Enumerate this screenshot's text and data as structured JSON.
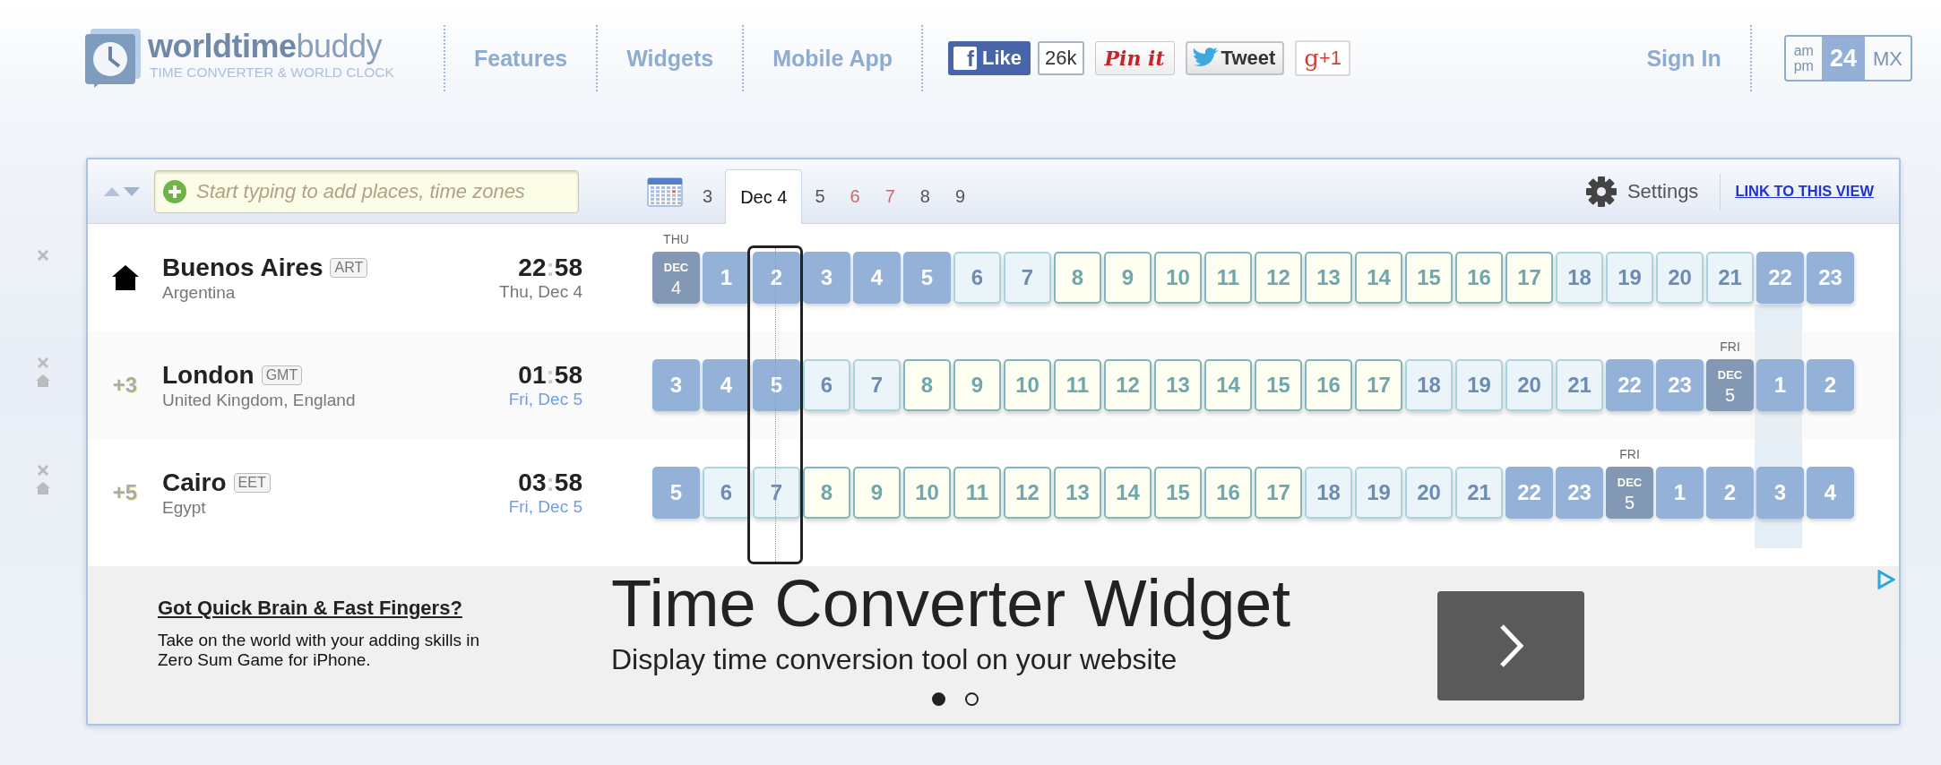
{
  "header": {
    "logo": {
      "text": "**worldtime**buddy",
      "tagline": "TIME CONVERTER & WORLD CLOCK"
    },
    "nav": [
      {
        "label": "Features"
      },
      {
        "label": "Widgets"
      },
      {
        "label": "Mobile App"
      }
    ],
    "social": [
      {
        "kind": "facebook",
        "icon_text": "f",
        "label": "Like",
        "count": "26k"
      },
      {
        "kind": "pinterest",
        "label": "Pin it"
      },
      {
        "kind": "twitter",
        "label": "Tweet"
      },
      {
        "kind": "google",
        "icon_text": "g",
        "label": "+1"
      }
    ],
    "sign_in": "Sign In",
    "time_format": [
      {
        "lines": [
          "am",
          "pm"
        ],
        "selected": false
      },
      {
        "lines": [
          "24"
        ],
        "selected": true
      },
      {
        "lines": [
          "MX"
        ],
        "selected": false
      }
    ]
  },
  "toolbar": {
    "search": {
      "placeholder": "Start typing to add places, time zones"
    },
    "date_tabs": [
      {
        "label": "3",
        "selected": false,
        "weekend": false
      },
      {
        "label": "Dec 4",
        "selected": true,
        "weekend": false
      },
      {
        "label": "5",
        "selected": false,
        "weekend": false
      },
      {
        "label": "6",
        "selected": false,
        "weekend": true
      },
      {
        "label": "7",
        "selected": false,
        "weekend": true
      },
      {
        "label": "8",
        "selected": false,
        "weekend": false
      },
      {
        "label": "9",
        "selected": false,
        "weekend": false
      }
    ],
    "settings": "Settings",
    "link": "LINK TO THIS VIEW"
  },
  "hour_columns": [
    {
      "selected": false,
      "highlighted": false
    },
    {
      "selected": false,
      "highlighted": false
    },
    {
      "selected": true,
      "highlighted": false
    },
    {
      "selected": false,
      "highlighted": false
    },
    {
      "selected": false,
      "highlighted": false
    },
    {
      "selected": false,
      "highlighted": false
    },
    {
      "selected": false,
      "highlighted": false
    },
    {
      "selected": false,
      "highlighted": false
    },
    {
      "selected": false,
      "highlighted": false
    },
    {
      "selected": false,
      "highlighted": false
    },
    {
      "selected": false,
      "highlighted": false
    },
    {
      "selected": false,
      "highlighted": false
    },
    {
      "selected": false,
      "highlighted": false
    },
    {
      "selected": false,
      "highlighted": false
    },
    {
      "selected": false,
      "highlighted": false
    },
    {
      "selected": false,
      "highlighted": false
    },
    {
      "selected": false,
      "highlighted": false
    },
    {
      "selected": false,
      "highlighted": false
    },
    {
      "selected": false,
      "highlighted": false
    },
    {
      "selected": false,
      "highlighted": false
    },
    {
      "selected": false,
      "highlighted": false
    },
    {
      "selected": false,
      "highlighted": false
    },
    {
      "selected": false,
      "highlighted": true
    },
    {
      "selected": false,
      "highlighted": false
    }
  ],
  "locations": [
    {
      "home": true,
      "name": "Buenos Aires",
      "abbr": "ART",
      "country": "Argentina",
      "hours": "22",
      "separator": ":",
      "minutes": "58",
      "date": "Thu, Dec 4",
      "other_day": false,
      "cells": [
        {
          "kind": "date",
          "month": "DEC",
          "label": "4",
          "day": "THU"
        },
        {
          "kind": "night",
          "label": "1"
        },
        {
          "kind": "night",
          "label": "2"
        },
        {
          "kind": "night",
          "label": "3"
        },
        {
          "kind": "night",
          "label": "4"
        },
        {
          "kind": "night",
          "label": "5"
        },
        {
          "kind": "dawn",
          "label": "6"
        },
        {
          "kind": "dawn",
          "label": "7"
        },
        {
          "kind": "day",
          "label": "8"
        },
        {
          "kind": "day",
          "label": "9"
        },
        {
          "kind": "day",
          "label": "10"
        },
        {
          "kind": "day",
          "label": "11"
        },
        {
          "kind": "day",
          "label": "12"
        },
        {
          "kind": "day",
          "label": "13"
        },
        {
          "kind": "day",
          "label": "14"
        },
        {
          "kind": "day",
          "label": "15"
        },
        {
          "kind": "day",
          "label": "16"
        },
        {
          "kind": "day",
          "label": "17"
        },
        {
          "kind": "dawn",
          "label": "18"
        },
        {
          "kind": "dawn",
          "label": "19"
        },
        {
          "kind": "dawn",
          "label": "20"
        },
        {
          "kind": "dawn",
          "label": "21"
        },
        {
          "kind": "night",
          "label": "22"
        },
        {
          "kind": "night",
          "label": "23"
        }
      ]
    },
    {
      "home": false,
      "offset": "+3",
      "name": "London",
      "abbr": "GMT",
      "country": "United Kingdom, England",
      "hours": "01",
      "separator": ":",
      "minutes": "58",
      "date": "Fri, Dec 5",
      "other_day": true,
      "cells": [
        {
          "kind": "night",
          "label": "3"
        },
        {
          "kind": "night",
          "label": "4"
        },
        {
          "kind": "night",
          "label": "5"
        },
        {
          "kind": "dawn",
          "label": "6"
        },
        {
          "kind": "dawn",
          "label": "7"
        },
        {
          "kind": "day",
          "label": "8"
        },
        {
          "kind": "day",
          "label": "9"
        },
        {
          "kind": "day",
          "label": "10"
        },
        {
          "kind": "day",
          "label": "11"
        },
        {
          "kind": "day",
          "label": "12"
        },
        {
          "kind": "day",
          "label": "13"
        },
        {
          "kind": "day",
          "label": "14"
        },
        {
          "kind": "day",
          "label": "15"
        },
        {
          "kind": "day",
          "label": "16"
        },
        {
          "kind": "day",
          "label": "17"
        },
        {
          "kind": "dawn",
          "label": "18"
        },
        {
          "kind": "dawn",
          "label": "19"
        },
        {
          "kind": "dawn",
          "label": "20"
        },
        {
          "kind": "dawn",
          "label": "21"
        },
        {
          "kind": "night",
          "label": "22"
        },
        {
          "kind": "night",
          "label": "23"
        },
        {
          "kind": "date",
          "month": "DEC",
          "label": "5",
          "day": "FRI"
        },
        {
          "kind": "night",
          "label": "1"
        },
        {
          "kind": "night",
          "label": "2"
        }
      ]
    },
    {
      "home": false,
      "offset": "+5",
      "name": "Cairo",
      "abbr": "EET",
      "country": "Egypt",
      "hours": "03",
      "separator": ":",
      "minutes": "58",
      "date": "Fri, Dec 5",
      "other_day": true,
      "cells": [
        {
          "kind": "night",
          "label": "5"
        },
        {
          "kind": "dawn",
          "label": "6"
        },
        {
          "kind": "dawn",
          "label": "7"
        },
        {
          "kind": "day",
          "label": "8"
        },
        {
          "kind": "day",
          "label": "9"
        },
        {
          "kind": "day",
          "label": "10"
        },
        {
          "kind": "day",
          "label": "11"
        },
        {
          "kind": "day",
          "label": "12"
        },
        {
          "kind": "day",
          "label": "13"
        },
        {
          "kind": "day",
          "label": "14"
        },
        {
          "kind": "day",
          "label": "15"
        },
        {
          "kind": "day",
          "label": "16"
        },
        {
          "kind": "day",
          "label": "17"
        },
        {
          "kind": "dawn",
          "label": "18"
        },
        {
          "kind": "dawn",
          "label": "19"
        },
        {
          "kind": "dawn",
          "label": "20"
        },
        {
          "kind": "dawn",
          "label": "21"
        },
        {
          "kind": "night",
          "label": "22"
        },
        {
          "kind": "night",
          "label": "23"
        },
        {
          "kind": "date",
          "month": "DEC",
          "label": "5",
          "day": "FRI"
        },
        {
          "kind": "night",
          "label": "1"
        },
        {
          "kind": "night",
          "label": "2"
        },
        {
          "kind": "night",
          "label": "3"
        },
        {
          "kind": "night",
          "label": "4"
        }
      ]
    }
  ],
  "ad": {
    "title": "Got Quick Brain & Fast Fingers?",
    "text": "Take on the world with your adding skills in Zero Sum Game for iPhone.",
    "headline": "Time Converter Widget",
    "subline": "Display time conversion tool on your website",
    "dots": [
      {
        "selected": true
      },
      {
        "selected": false
      }
    ]
  }
}
